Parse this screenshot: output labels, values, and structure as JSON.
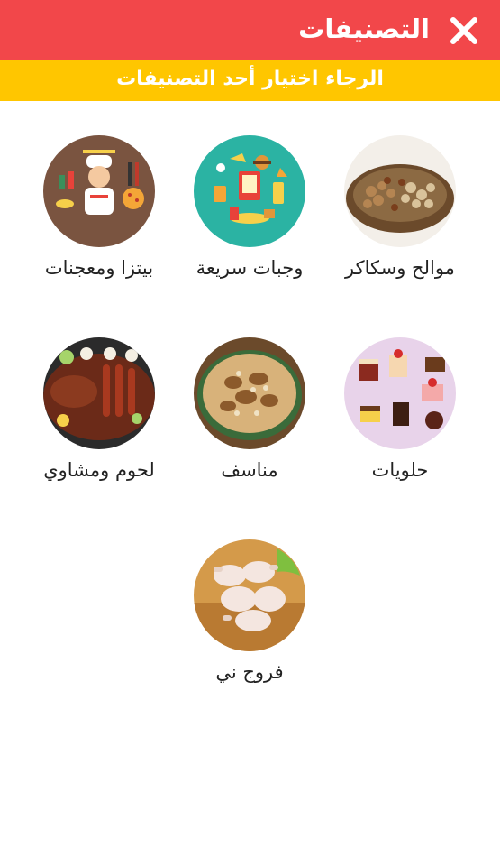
{
  "header": {
    "title": "التصنيفات",
    "close_icon": "close-icon"
  },
  "banner": {
    "text": "الرجاء اختيار أحد التصنيفات"
  },
  "colors": {
    "appbar": "#f2474a",
    "banner": "#ffc600"
  },
  "categories": [
    {
      "label": "موالح وسكاكر",
      "icon": "nuts-image"
    },
    {
      "label": "وجبات سريعة",
      "icon": "fast-food-image"
    },
    {
      "label": "بيتزا ومعجنات",
      "icon": "pizza-chef-image"
    },
    {
      "label": "حلويات",
      "icon": "desserts-image"
    },
    {
      "label": "مناسف",
      "icon": "mansaf-image"
    },
    {
      "label": "لحوم ومشاوي",
      "icon": "grilled-meat-image"
    },
    {
      "label": "فروج ني",
      "icon": "raw-chicken-image"
    }
  ]
}
